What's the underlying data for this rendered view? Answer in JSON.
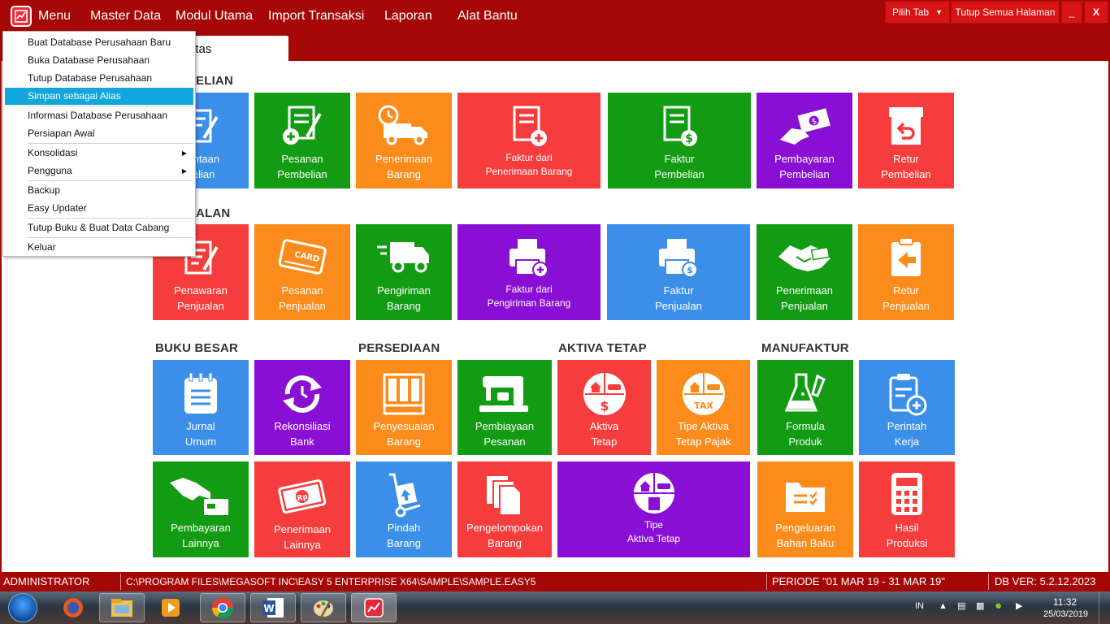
{
  "menubar": {
    "items": [
      "Menu",
      "Master Data",
      "Modul Utama",
      "Import Transaksi",
      "Laporan",
      "Alat Bantu"
    ],
    "pilih_tab": "Pilih Tab",
    "tutup_semua": "Tutup Semua Halaman",
    "minimize": "_",
    "close": "X"
  },
  "tab": {
    "label": "ntas"
  },
  "dropdown": {
    "items": [
      "Buat Database Perusahaan Baru",
      "Buka Database Perusahaan",
      "Tutup Database Perusahaan",
      "Simpan sebagai Alias",
      "Informasi Database Perusahaan",
      "Persiapan Awal",
      "Konsolidasi",
      "Pengguna",
      "Backup",
      "Easy Updater",
      "Tutup Buku & Buat Data Cabang",
      "Keluar"
    ],
    "highlighted_index": 3
  },
  "sections": {
    "pembelian": "ELIAN",
    "penjualan": "ALAN",
    "buku_besar": "BUKU BESAR",
    "persediaan": "PERSEDIAAN",
    "aktiva_tetap": "AKTIVA TETAP",
    "manufaktur": "MANUFAKTUR"
  },
  "tiles": {
    "permintaan_pembelian": "mintaan\nbelian",
    "pesanan_pembelian": "Pesanan\nPembelian",
    "penerimaan_barang": "Penerimaan\nBarang",
    "faktur_penerimaan": "Faktur dari\nPenerimaan Barang",
    "faktur_pembelian": "Faktur\nPembelian",
    "pembayaran_pembelian": "Pembayaran\nPembelian",
    "retur_pembelian": "Retur\nPembelian",
    "penawaran_penjualan": "Penawaran\nPenjualan",
    "pesanan_penjualan": "Pesanan\nPenjualan",
    "pengiriman_barang": "Pengiriman\nBarang",
    "faktur_pengiriman": "Faktur dari\nPengiriman Barang",
    "faktur_penjualan": "Faktur\nPenjualan",
    "penerimaan_penjualan": "Penerimaan\nPenjualan",
    "retur_penjualan": "Retur\nPenjualan",
    "jurnal_umum": "Jurnal\nUmum",
    "rekonsiliasi_bank": "Rekonsiliasi\nBank",
    "penyesuaian_barang": "Penyesuaian\nBarang",
    "pembiayaan_pesanan": "Pembiayaan\nPesanan",
    "aktiva_tetap": "Aktiva\nTetap",
    "tipe_aktiva_pajak": "Tipe Aktiva\nTetap Pajak",
    "formula_produk": "Formula\nProduk",
    "perintah_kerja": "Perintah\nKerja",
    "pembayaran_lainnya": "Pembayaran\nLainnya",
    "penerimaan_lainnya": "Penerimaan\nLainnya",
    "pindah_barang": "Pindah\nBarang",
    "pengelompokan_barang": "Pengelompokan\nBarang",
    "tipe_aktiva_tetap": "Tipe\nAktiva Tetap",
    "pengeluaran_bahan_baku": "Pengeluaran\nBahan Baku",
    "hasil_produksi": "Hasil\nProduksi"
  },
  "icon_text": {
    "card": "CARD",
    "tax": "TAX",
    "rp": "Rp"
  },
  "statusbar": {
    "user": "ADMINISTRATOR",
    "path": "C:\\PROGRAM FILES\\MEGASOFT INC\\EASY 5 ENTERPRISE X64\\SAMPLE\\SAMPLE.EASY5",
    "periode": "PERIODE \"01 MAR 19 - 31 MAR 19\"",
    "dbver": "DB VER: 5.2.12.2023"
  },
  "taskbar": {
    "lang": "IN",
    "time": "11:32",
    "date": "25/03/2019"
  },
  "colors": {
    "brand_red": "#a50707",
    "blue": "#3b8fe8",
    "green": "#139c13",
    "orange": "#fb8c1c",
    "red": "#f53d3d",
    "purple": "#8a0fd5",
    "highlight": "#11a6dc"
  }
}
